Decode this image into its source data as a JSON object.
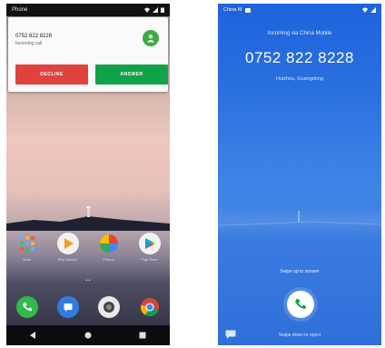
{
  "left_phone": {
    "status_app": "Phone",
    "call_card": {
      "number": "0752 822 8228",
      "status": "Incoming call",
      "decline_label": "DECLINE",
      "answer_label": "ANSWER"
    },
    "apps": [
      {
        "name": "Tools",
        "icon": "apps-grid-icon"
      },
      {
        "name": "Play Movies",
        "icon": "play-movies-icon"
      },
      {
        "name": "Photos",
        "icon": "photos-icon"
      },
      {
        "name": "Play Store",
        "icon": "play-store-icon"
      }
    ],
    "dock": [
      "phone-icon",
      "messages-icon",
      "camera-icon",
      "chrome-icon"
    ],
    "colors": {
      "decline": "#e0433b",
      "answer": "#12a24a",
      "avatar": "#3eab45"
    }
  },
  "right_phone": {
    "status_left": "China M",
    "incoming_label": "Incoming via China Mobile",
    "number": "0752 822 8228",
    "location": "Huizhou, Guangdong",
    "swipe_up_label": "Swipe up to answer",
    "swipe_down_label": "Swipe down to reject",
    "colors": {
      "background": "#2a6fe0",
      "call_icon": "#12a24a"
    }
  }
}
